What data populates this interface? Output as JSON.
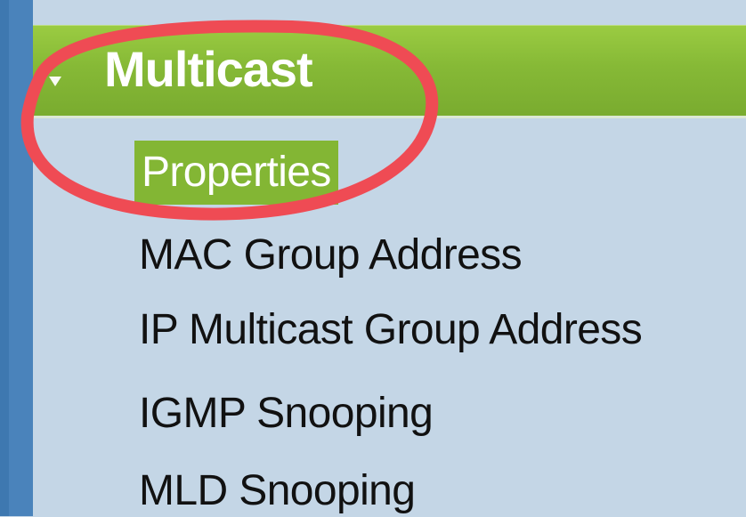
{
  "sidebar": {
    "section": {
      "title": "Multicast",
      "expand_icon": "triangle-down-icon"
    },
    "items": [
      {
        "label": "Properties",
        "selected": true
      },
      {
        "label": "MAC Group Address",
        "selected": false
      },
      {
        "label": "IP Multicast Group Address",
        "selected": false
      },
      {
        "label": "IGMP Snooping",
        "selected": false
      },
      {
        "label": "MLD Snooping",
        "selected": false
      }
    ]
  },
  "colors": {
    "panel_background": "#c4d6e6",
    "left_strip": "#3e78b0",
    "header_green": "#86b936",
    "selected_background": "#83b634",
    "annotation_red": "#ef4b54"
  }
}
